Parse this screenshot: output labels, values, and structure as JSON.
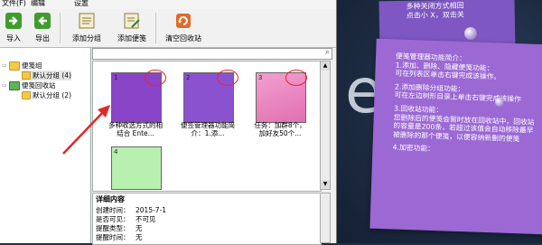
{
  "menu": [
    "文件(F)",
    "编辑",
    "设置"
  ],
  "toolbar": {
    "import": "导入",
    "export": "导出",
    "add_group": "添加分组",
    "add_note": "添加便笺",
    "empty_recycle": "清空回收站"
  },
  "tree": {
    "root": "便笺组",
    "default_group": "默认分组 (4)",
    "recycle": "便笺回收站",
    "recycle_default": "默认分组 (2)"
  },
  "search": {
    "placeholder": ""
  },
  "notes": [
    {
      "num": "1",
      "title": "多种收选方式的相结合 Ente...",
      "color": "#8a44c8"
    },
    {
      "num": "2",
      "title": "便签管理器功能简介：1.添...",
      "color": "#8b52d0"
    },
    {
      "num": "3",
      "title": "任务：加群8个，加好友50个...",
      "color": "#e880b8"
    },
    {
      "num": "4",
      "title": "",
      "color": "#b8f0b0"
    }
  ],
  "detail": {
    "heading": "详细内容",
    "rows": [
      {
        "k": "创建时间：",
        "v": "2015-7-1"
      },
      {
        "k": "是否可见：",
        "v": "不可见"
      },
      {
        "k": "提醒类型：",
        "v": "无"
      },
      {
        "k": "提醒时间：",
        "v": "无"
      }
    ]
  },
  "desktop": {
    "big_letter": "e",
    "back_note": "多种关闭方式相回\n点击小 X，双击关",
    "main_note": [
      "便笺管理器功能简介：\n1.添加、删除、隐藏便笺功能：\n可在列表区单击右键完成该操作。",
      "2.添加删除分组功能：\n可在左边树形目录上单击右键完成该操作",
      "3.回收站功能：\n您删除后的便笺会暂时放在回收站中，回收站的容量是200条，若超过该值会自动移除最早被删除的那个便笺，以便容纳新删的便笺",
      "4.加密功能："
    ]
  },
  "colors": {
    "accent_red": "#e02828",
    "note_purple": "#9b68d4"
  }
}
